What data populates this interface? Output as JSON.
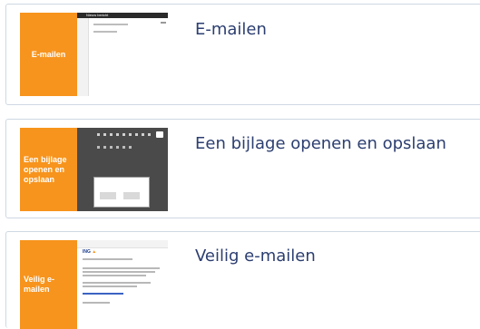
{
  "colors": {
    "accent_orange": "#f7941d",
    "title_blue": "#2c3e70",
    "card_border": "#cfd8e3"
  },
  "cards": [
    {
      "title": "E-mailen",
      "thumb_label": "E-mailen",
      "thumb_topbar": "Nieuw bericht"
    },
    {
      "title": "Een bijlage openen en opslaan",
      "thumb_label": "Een bijlage openen en opslaan"
    },
    {
      "title": "Veilig e-mailen",
      "thumb_label": "Veilig e-mailen",
      "thumb_logo": "ING"
    }
  ]
}
